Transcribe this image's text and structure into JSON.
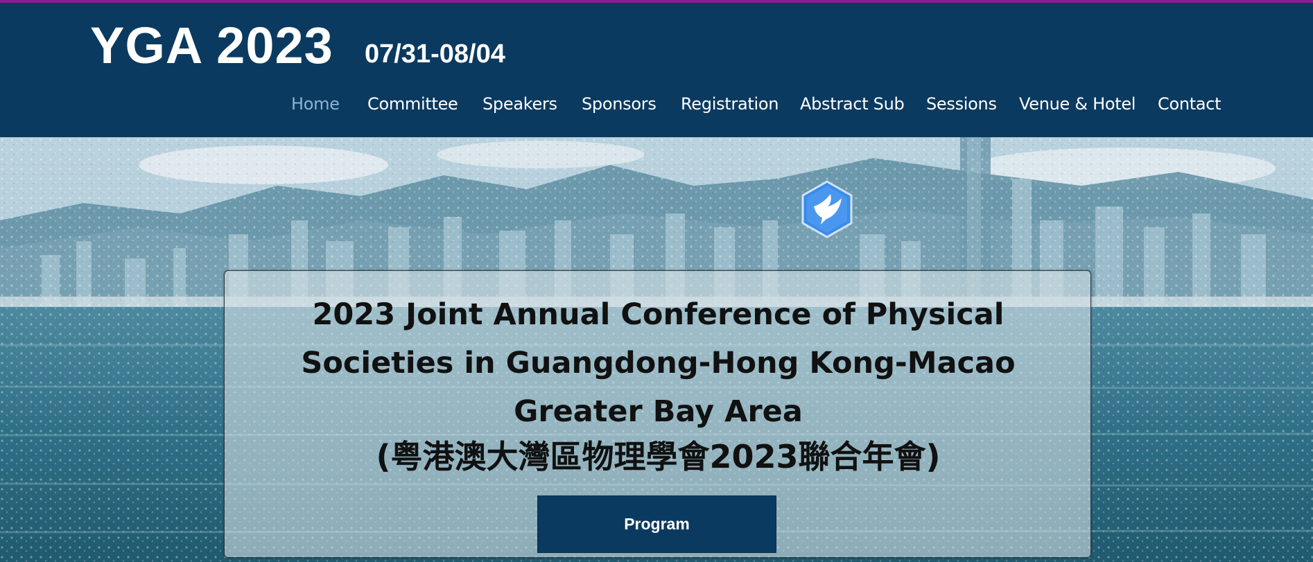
{
  "site": {
    "title": "YGA 2023",
    "dates": "07/31-08/04"
  },
  "nav": {
    "items": [
      {
        "label": "Home",
        "active": true
      },
      {
        "label": "Committee"
      },
      {
        "label": "Speakers"
      },
      {
        "label": "Sponsors"
      },
      {
        "label": "Registration"
      },
      {
        "label": "Abstract Sub"
      },
      {
        "label": "Sessions"
      },
      {
        "label": "Venue & Hotel"
      },
      {
        "label": "Contact"
      }
    ]
  },
  "hero": {
    "title_line1": "2023 Joint Annual Conference of Physical",
    "title_line2": "Societies in Guangdong-Hong Kong-Macao",
    "title_line3": "Greater Bay Area",
    "title_cn": "(粤港澳大灣區物理學會2023聯合年會)",
    "program_button": "Program",
    "logo_icon": "dove-icon"
  },
  "colors": {
    "header_bg": "#0b3a60",
    "top_accent": "#8e1b92",
    "nav_active": "#8db3d6",
    "button_bg": "#0b3a60"
  }
}
